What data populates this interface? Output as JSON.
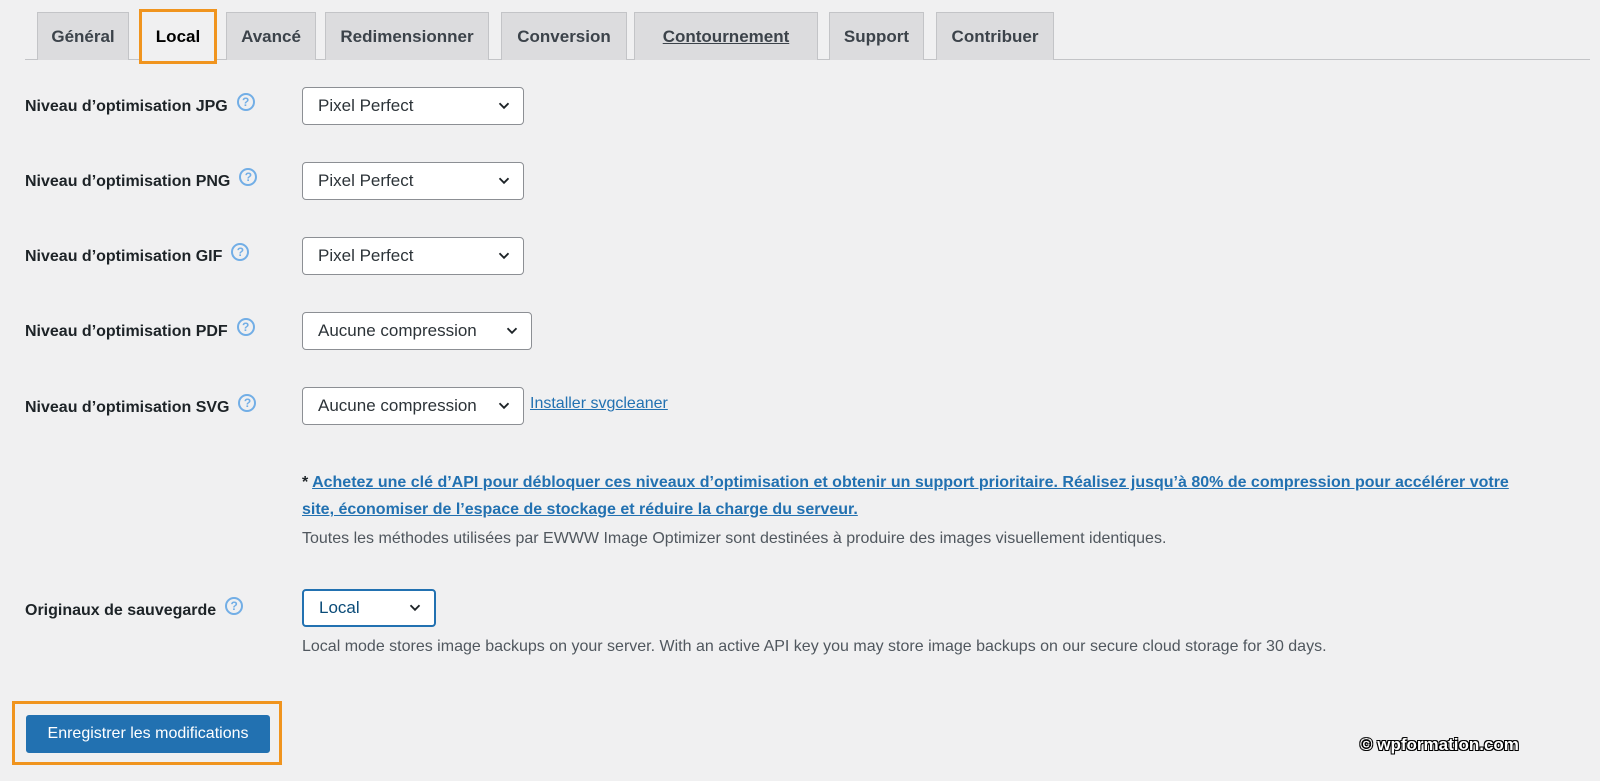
{
  "tabs": [
    {
      "label": "Général"
    },
    {
      "label": "Local"
    },
    {
      "label": "Avancé"
    },
    {
      "label": "Redimensionner"
    },
    {
      "label": "Conversion"
    },
    {
      "label": "Contournement"
    },
    {
      "label": "Support"
    },
    {
      "label": "Contribuer"
    }
  ],
  "settings": {
    "jpg": {
      "label": "Niveau d’optimisation JPG",
      "value": "Pixel Perfect"
    },
    "png": {
      "label": "Niveau d’optimisation PNG",
      "value": "Pixel Perfect"
    },
    "gif": {
      "label": "Niveau d’optimisation GIF",
      "value": "Pixel Perfect"
    },
    "pdf": {
      "label": "Niveau d’optimisation PDF",
      "value": "Aucune compression"
    },
    "svg": {
      "label": "Niveau d’optimisation SVG",
      "value": "Aucune compression",
      "link": "Installer svgcleaner"
    },
    "backup": {
      "label": "Originaux de sauvegarde",
      "value": "Local"
    }
  },
  "help_glyph": "?",
  "promo": {
    "star": "* ",
    "link": "Achetez une clé d’API pour débloquer ces niveaux d’optimisation et obtenir un support prioritaire. Réalisez jusqu’à 80% de compression pour accélérer votre site, économiser de l’espace de stockage et réduire la charge du serveur."
  },
  "methods_note": "Toutes les méthodes utilisées par EWWW Image Optimizer sont destinées à produire des images visuellement identiques.",
  "backup_note": "Local mode stores image backups on your server. With an active API key you may store image backups on our secure cloud storage for 30 days.",
  "save_button": "Enregistrer les modifications",
  "watermark": "© wpformation.com",
  "colors": {
    "accent": "#2271b1",
    "highlight": "#f0941e",
    "background": "#f0f0f1"
  }
}
